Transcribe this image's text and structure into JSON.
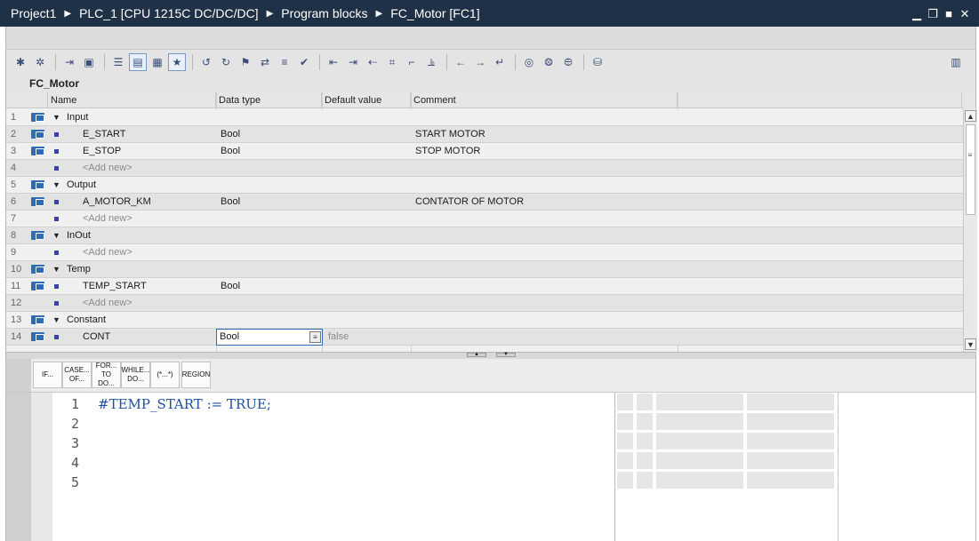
{
  "breadcrumb": [
    "Project1",
    "PLC_1 [CPU 1215C DC/DC/DC]",
    "Program blocks",
    "FC_Motor [FC1]"
  ],
  "window_controls": [
    "minimize",
    "restore",
    "maximize",
    "close"
  ],
  "block_name": "FC_Motor",
  "columns": [
    "Name",
    "Data type",
    "Default value",
    "Comment"
  ],
  "rows": [
    {
      "n": "1",
      "kind": "section",
      "name": "Input",
      "type": "",
      "default": "",
      "comment": ""
    },
    {
      "n": "2",
      "kind": "var",
      "name": "E_START",
      "type": "Bool",
      "default": "",
      "comment": "START MOTOR"
    },
    {
      "n": "3",
      "kind": "var",
      "name": "E_STOP",
      "type": "Bool",
      "default": "",
      "comment": "STOP MOTOR"
    },
    {
      "n": "4",
      "kind": "add",
      "name": "<Add new>",
      "type": "",
      "default": "",
      "comment": ""
    },
    {
      "n": "5",
      "kind": "section",
      "name": "Output",
      "type": "",
      "default": "",
      "comment": ""
    },
    {
      "n": "6",
      "kind": "var",
      "name": "A_MOTOR_KM",
      "type": "Bool",
      "default": "",
      "comment": "CONTATOR OF MOTOR"
    },
    {
      "n": "7",
      "kind": "add",
      "name": "<Add new>",
      "type": "",
      "default": "",
      "comment": ""
    },
    {
      "n": "8",
      "kind": "section",
      "name": "InOut",
      "type": "",
      "default": "",
      "comment": ""
    },
    {
      "n": "9",
      "kind": "add",
      "name": "<Add new>",
      "type": "",
      "default": "",
      "comment": ""
    },
    {
      "n": "10",
      "kind": "section",
      "name": "Temp",
      "type": "",
      "default": "",
      "comment": ""
    },
    {
      "n": "11",
      "kind": "var",
      "name": "TEMP_START",
      "type": "Bool",
      "default": "",
      "comment": ""
    },
    {
      "n": "12",
      "kind": "add",
      "name": "<Add new>",
      "type": "",
      "default": "",
      "comment": ""
    },
    {
      "n": "13",
      "kind": "section",
      "name": "Constant",
      "type": "",
      "default": "",
      "comment": ""
    },
    {
      "n": "14",
      "kind": "var",
      "name": "CONT",
      "type": "Bool",
      "default": "false",
      "comment": "",
      "editing": true
    }
  ],
  "scl_buttons": [
    "IF...",
    "CASE... OF...",
    "FOR... TO DO...",
    "WHILE... DO...",
    "(*...*)",
    "REGION"
  ],
  "code_lines": [
    "#TEMP_START := TRUE;",
    "",
    "",
    "",
    ""
  ],
  "line_numbers": [
    "1",
    "2",
    "3",
    "4",
    "5"
  ]
}
